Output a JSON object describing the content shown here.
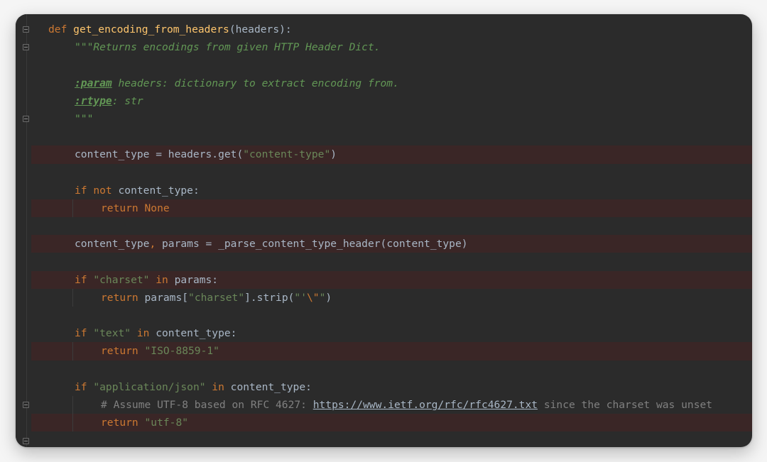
{
  "editor": {
    "lines": [
      {
        "indent": 0,
        "hl": false,
        "tokens": [
          {
            "t": "kw",
            "v": "def "
          },
          {
            "t": "fn",
            "v": "get_encoding_from_headers"
          },
          {
            "t": "id",
            "v": "(headers):"
          }
        ]
      },
      {
        "indent": 1,
        "hl": false,
        "tokens": [
          {
            "t": "doc",
            "v": "\"\"\"Returns encodings from given HTTP Header Dict."
          }
        ]
      },
      {
        "indent": 1,
        "hl": false,
        "tokens": []
      },
      {
        "indent": 1,
        "hl": false,
        "tokens": [
          {
            "t": "doctag",
            "v": ":param"
          },
          {
            "t": "doc",
            "v": " headers: dictionary to extract encoding from."
          }
        ]
      },
      {
        "indent": 1,
        "hl": false,
        "tokens": [
          {
            "t": "doctag",
            "v": ":rtype"
          },
          {
            "t": "doc",
            "v": ": str"
          }
        ]
      },
      {
        "indent": 1,
        "hl": false,
        "tokens": [
          {
            "t": "doc",
            "v": "\"\"\""
          }
        ]
      },
      {
        "indent": 1,
        "hl": false,
        "tokens": []
      },
      {
        "indent": 1,
        "hl": true,
        "tokens": [
          {
            "t": "id",
            "v": "content_type = headers.get("
          },
          {
            "t": "str",
            "v": "\"content-type\""
          },
          {
            "t": "id",
            "v": ")"
          }
        ]
      },
      {
        "indent": 1,
        "hl": false,
        "tokens": []
      },
      {
        "indent": 1,
        "hl": false,
        "tokens": [
          {
            "t": "kw",
            "v": "if not "
          },
          {
            "t": "id",
            "v": "content_type:"
          }
        ]
      },
      {
        "indent": 2,
        "hl": true,
        "tokens": [
          {
            "t": "kw",
            "v": "return None"
          }
        ]
      },
      {
        "indent": 1,
        "hl": false,
        "tokens": []
      },
      {
        "indent": 1,
        "hl": true,
        "tokens": [
          {
            "t": "id",
            "v": "content_type"
          },
          {
            "t": "kw",
            "v": ", "
          },
          {
            "t": "id",
            "v": "params = _parse_content_type_header(content_type)"
          }
        ]
      },
      {
        "indent": 1,
        "hl": false,
        "tokens": []
      },
      {
        "indent": 1,
        "hl": true,
        "tokens": [
          {
            "t": "kw",
            "v": "if "
          },
          {
            "t": "str",
            "v": "\"charset\""
          },
          {
            "t": "kw",
            "v": " in "
          },
          {
            "t": "id",
            "v": "params:"
          }
        ]
      },
      {
        "indent": 2,
        "hl": false,
        "tokens": [
          {
            "t": "kw",
            "v": "return "
          },
          {
            "t": "id",
            "v": "params["
          },
          {
            "t": "str",
            "v": "\"charset\""
          },
          {
            "t": "id",
            "v": "].strip("
          },
          {
            "t": "str",
            "v": "\"'"
          },
          {
            "t": "kw",
            "v": "\\\""
          },
          {
            "t": "str",
            "v": "\""
          },
          {
            "t": "id",
            "v": ")"
          }
        ]
      },
      {
        "indent": 1,
        "hl": false,
        "tokens": []
      },
      {
        "indent": 1,
        "hl": false,
        "tokens": [
          {
            "t": "kw",
            "v": "if "
          },
          {
            "t": "str",
            "v": "\"text\""
          },
          {
            "t": "kw",
            "v": " in "
          },
          {
            "t": "id",
            "v": "content_type:"
          }
        ]
      },
      {
        "indent": 2,
        "hl": true,
        "tokens": [
          {
            "t": "kw",
            "v": "return "
          },
          {
            "t": "str",
            "v": "\"ISO-8859-1\""
          }
        ]
      },
      {
        "indent": 1,
        "hl": false,
        "tokens": []
      },
      {
        "indent": 1,
        "hl": false,
        "tokens": [
          {
            "t": "kw",
            "v": "if "
          },
          {
            "t": "str",
            "v": "\"application/json\""
          },
          {
            "t": "kw",
            "v": " in "
          },
          {
            "t": "id",
            "v": "content_type:"
          }
        ]
      },
      {
        "indent": 2,
        "hl": false,
        "tokens": [
          {
            "t": "cmt",
            "v": "# Assume UTF-8 based on RFC 4627: "
          },
          {
            "t": "link",
            "v": "https://www.ietf.org/rfc/rfc4627.txt"
          },
          {
            "t": "cmt",
            "v": " since the charset was unset"
          }
        ]
      },
      {
        "indent": 2,
        "hl": true,
        "tokens": [
          {
            "t": "kw",
            "v": "return "
          },
          {
            "t": "str",
            "v": "\"utf-8\""
          }
        ]
      }
    ],
    "fold_marker_lines": [
      0,
      1,
      5,
      21,
      23
    ]
  }
}
